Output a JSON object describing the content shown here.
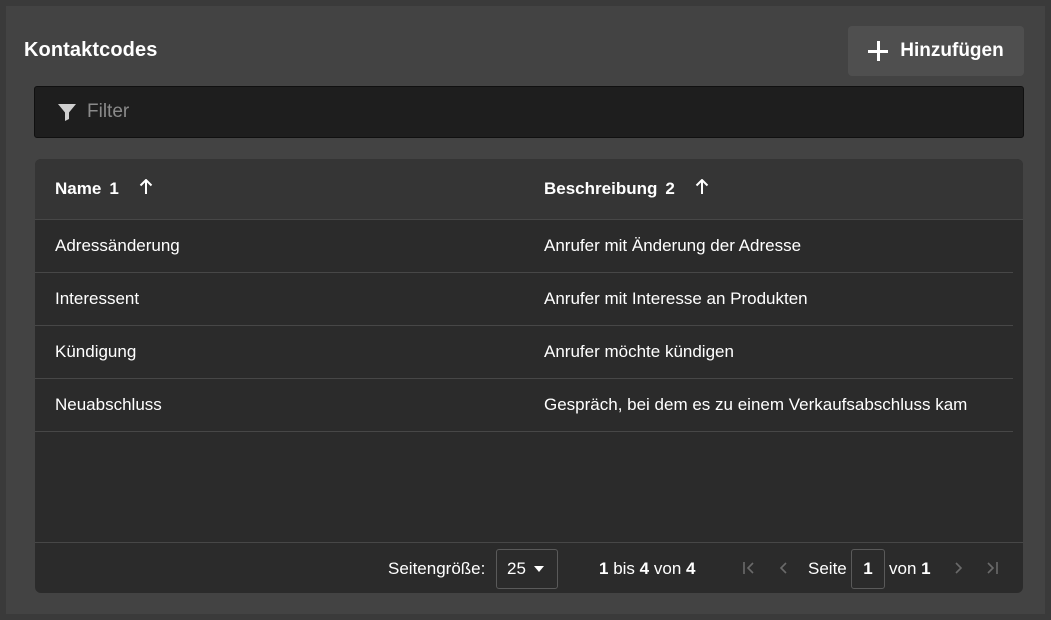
{
  "header": {
    "title": "Kontaktcodes",
    "add_label": "Hinzufügen"
  },
  "filter": {
    "placeholder": "Filter",
    "value": ""
  },
  "table": {
    "columns": [
      {
        "label": "Name",
        "sort_index": "1",
        "sort_icon": "arrow-up-icon"
      },
      {
        "label": "Beschreibung",
        "sort_index": "2",
        "sort_icon": "arrow-up-icon"
      }
    ],
    "rows": [
      {
        "name": "Adressänderung",
        "description": "Anrufer mit Änderung der Adresse"
      },
      {
        "name": "Interessent",
        "description": "Anrufer mit Interesse an Produkten"
      },
      {
        "name": "Kündigung",
        "description": "Anrufer möchte kündigen"
      },
      {
        "name": "Neuabschluss",
        "description": "Gespräch, bei dem es zu einem Verkaufsabschluss kam"
      }
    ]
  },
  "pagination": {
    "page_size_label": "Seitengröße:",
    "page_size": "25",
    "from": "1",
    "bis": "bis",
    "to": "4",
    "von": "von",
    "total": "4",
    "page_label": "Seite",
    "current_page": "1",
    "page_of": "von",
    "total_pages": "1"
  },
  "colors": {
    "background": "#3a3a3a",
    "panel": "#434343",
    "grid": "#2b2b2b",
    "grid_header": "#353535",
    "filter_bg": "#1e1e1e"
  }
}
